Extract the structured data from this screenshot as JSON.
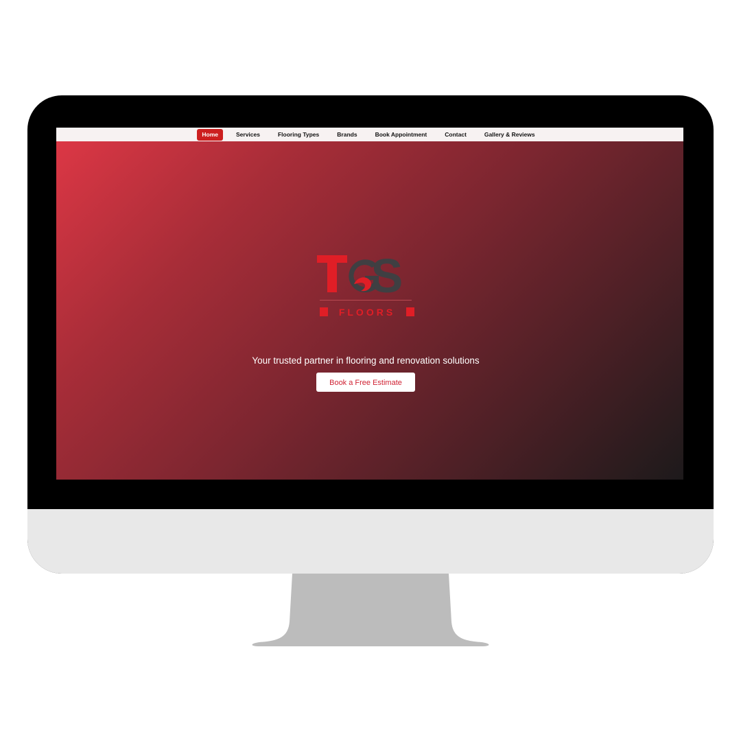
{
  "nav": {
    "items": [
      {
        "label": "Home",
        "active": true
      },
      {
        "label": "Services",
        "active": false
      },
      {
        "label": "Flooring Types",
        "active": false
      },
      {
        "label": "Brands",
        "active": false
      },
      {
        "label": "Book Appointment",
        "active": false
      },
      {
        "label": "Contact",
        "active": false
      },
      {
        "label": "Gallery & Reviews",
        "active": false
      }
    ]
  },
  "hero": {
    "logo": {
      "letters": "TGS",
      "subtitle": "FLOORS"
    },
    "tagline": "Your trusted partner in flooring and renovation solutions",
    "cta_label": "Book a Free Estimate"
  },
  "colors": {
    "brand_red": "#cc1f1f",
    "logo_red": "#e01e26",
    "logo_gray": "#3f3f42",
    "gradient_start": "#dc3745",
    "gradient_end": "#1d1a1b",
    "monitor_bezel": "#000000",
    "monitor_chin": "#e8e8e8",
    "monitor_stand": "#bcbcbc"
  }
}
